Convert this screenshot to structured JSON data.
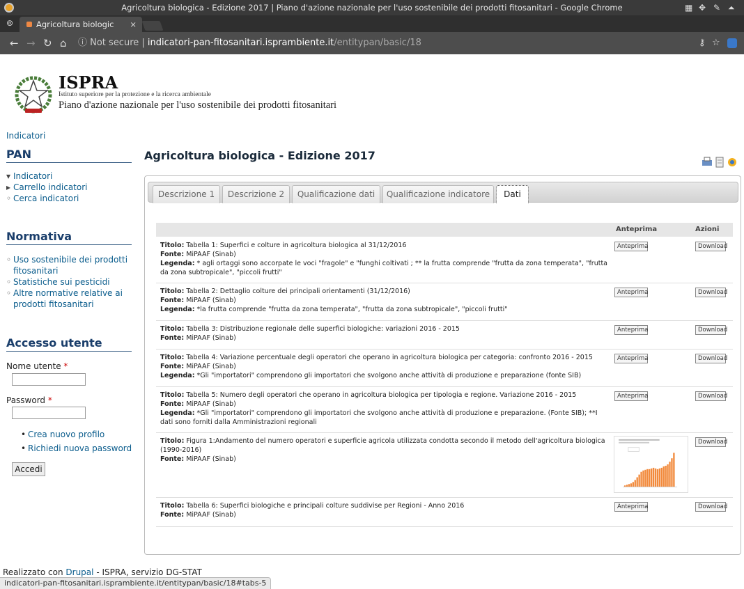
{
  "window": {
    "title": "Agricoltura biologica - Edizione 2017 | Piano d'azione nazionale per l'uso sostenibile dei prodotti fitosanitari - Google Chrome"
  },
  "browser": {
    "tab_title": "Agricoltura biologic",
    "tab_close": "×",
    "url_prefix": "ⓘ Not secure |",
    "url_host": "indicatori-pan-fitosanitari.isprambiente.it",
    "url_path": "/entitypan/basic/18"
  },
  "header": {
    "brand": "ISPRA",
    "institute": "Istituto superiore per la protezione e la ricerca ambientale",
    "plan": "Piano d'azione nazionale per l'uso sostenibile dei prodotti fitosanitari",
    "breadcrumb": "Indicatori"
  },
  "sidebar": {
    "pan_title": "PAN",
    "pan_items": [
      "Indicatori",
      "Carrello indicatori",
      "Cerca indicatori"
    ],
    "normativa_title": "Normativa",
    "normativa_items": [
      "Uso sostenibile dei prodotti fitosanitari",
      "Statistiche sui pesticidi",
      "Altre normative relative ai prodotti fitosanitari"
    ],
    "login_title": "Accesso utente",
    "username_label": "Nome utente",
    "password_label": "Password",
    "required_mark": "*",
    "create_profile": "Crea nuovo profilo",
    "new_password": "Richiedi nuova password",
    "submit": "Accedi"
  },
  "main": {
    "title": "Agricoltura biologica - Edizione 2017",
    "tabs": [
      "Descrizione 1",
      "Descrizione 2",
      "Qualificazione dati",
      "Qualificazione indicatore",
      "Dati"
    ],
    "active_tab": 4,
    "col_preview": "Anteprima",
    "col_actions": "Azioni",
    "label_title": "Titolo:",
    "label_source": "Fonte:",
    "label_legend": "Legenda:",
    "preview_button": "Anteprima",
    "download_button": "Download",
    "rows": [
      {
        "title": "Tabella 1: Superfici e colture in agricoltura biologica al 31/12/2016",
        "source": "MiPAAF (Sinab)",
        "legend": "* agli ortaggi sono accorpate le voci \"fragole\" e \"funghi coltivati ; ** la frutta comprende \"frutta da zona temperata\", \"frutta da zona subtropicale\", \"piccoli frutti\""
      },
      {
        "title": "Tabella 2: Dettaglio colture dei principali orientamenti (31/12/2016)",
        "source": "MiPAAF (Sinab)",
        "legend": "*la frutta comprende \"frutta da zona temperata\", \"frutta da zona subtropicale\", \"piccoli frutti\""
      },
      {
        "title": "Tabella 3: Distribuzione regionale delle superfici biologiche: variazioni 2016 - 2015",
        "source": "MiPAAF (Sinab)",
        "legend": ""
      },
      {
        "title": "Tabella 4: Variazione percentuale degli operatori che operano in agricoltura biologica per categoria: confronto 2016 - 2015",
        "source": "MiPAAF (Sinab)",
        "legend": "*Gli \"importatori\" comprendono gli importatori che svolgono anche attività di produzione e preparazione (fonte SIB)"
      },
      {
        "title": "Tabella 5: Numero degli operatori che operano in agricoltura biologica per tipologia e regione. Variazione 2016 - 2015",
        "source": "MiPAAF (Sinab)",
        "legend": "*Gli \"importatori\" comprendono gli importatori che svolgono anche attività di produzione e preparazione. (Fonte SIB); **I dati sono forniti dalla Amministrazioni regionali"
      },
      {
        "title": "Figura 1:Andamento del numero operatori e superficie agricola utilizzata condotta secondo il metodo dell'agricoltura biologica (1990-2016)",
        "source": "MiPAAF (Sinab)",
        "legend": ""
      },
      {
        "title": "Tabella 6: Superfici biologiche e principali colture suddivise per Regioni - Anno 2016",
        "source": "MiPAAF (Sinab)",
        "legend": ""
      }
    ]
  },
  "footer": {
    "prefix": "Realizzato con",
    "link": "Drupal",
    "suffix": "- ISPRA, servizio DG-STAT"
  },
  "status_bar": "indicatori-pan-fitosanitari.isprambiente.it/entitypan/basic/18#tabs-5",
  "colors": {
    "link": "#0a5c8c",
    "heading": "#1a3e6b",
    "chrome_dark": "#3a3a3a"
  }
}
